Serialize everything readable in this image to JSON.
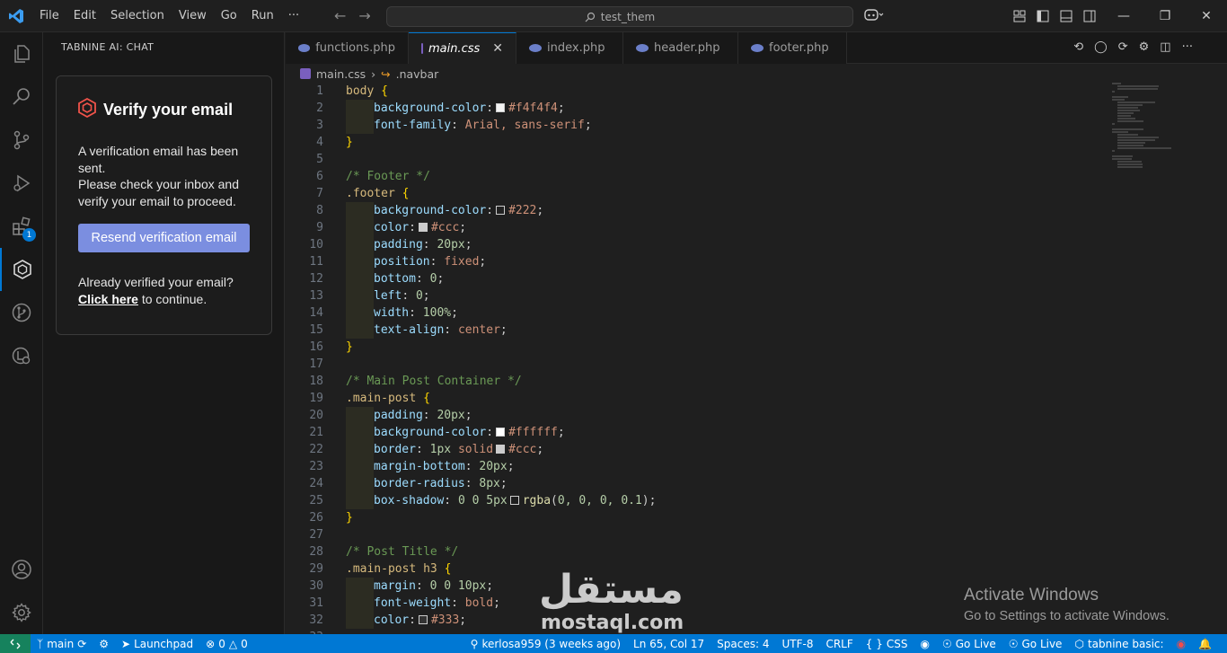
{
  "menu": [
    "File",
    "Edit",
    "Selection",
    "View",
    "Go",
    "Run",
    "···"
  ],
  "search": {
    "text": "test_them"
  },
  "side_panel": {
    "title": "TABNINE AI: CHAT",
    "card_title": "Verify your email",
    "line1": "A verification email has been sent.",
    "line2": "Please check your inbox and verify your email to proceed.",
    "button": "Resend verification email",
    "foot_pre": "Already verified your email?",
    "foot_link": "Click here",
    "foot_post": " to continue."
  },
  "activity": {
    "badge": "1"
  },
  "tabs": [
    {
      "label": "functions.php",
      "icon": "php"
    },
    {
      "label": "main.css",
      "icon": "css",
      "active": true
    },
    {
      "label": "index.php",
      "icon": "php"
    },
    {
      "label": "header.php",
      "icon": "php"
    },
    {
      "label": "footer.php",
      "icon": "php"
    }
  ],
  "breadcrumb": {
    "file": "main.css",
    "symbol": ".navbar"
  },
  "code": [
    [
      [
        "sel",
        "body"
      ],
      [
        "pun",
        " "
      ],
      [
        "brace",
        "{"
      ]
    ],
    [
      [
        "ind",
        ""
      ],
      [
        "prop",
        "background-color"
      ],
      [
        "pun",
        ":"
      ],
      [
        "sw",
        "#f4f4f4"
      ],
      [
        "val",
        "#f4f4f4"
      ],
      [
        "pun",
        ";"
      ]
    ],
    [
      [
        "ind",
        ""
      ],
      [
        "prop",
        "font-family"
      ],
      [
        "pun",
        ": "
      ],
      [
        "val",
        "Arial, sans-serif"
      ],
      [
        "pun",
        ";"
      ]
    ],
    [
      [
        "brace",
        "}"
      ]
    ],
    [],
    [
      [
        "cmt",
        "/* Footer */"
      ]
    ],
    [
      [
        "sel",
        ".footer"
      ],
      [
        "pun",
        " "
      ],
      [
        "brace",
        "{"
      ]
    ],
    [
      [
        "ind",
        ""
      ],
      [
        "prop",
        "background-color"
      ],
      [
        "pun",
        ":"
      ],
      [
        "sw",
        "#222222"
      ],
      [
        "val",
        "#222"
      ],
      [
        "pun",
        ";"
      ]
    ],
    [
      [
        "ind",
        ""
      ],
      [
        "prop",
        "color"
      ],
      [
        "pun",
        ":"
      ],
      [
        "sw",
        "#cccccc"
      ],
      [
        "val",
        "#ccc"
      ],
      [
        "pun",
        ";"
      ]
    ],
    [
      [
        "ind",
        ""
      ],
      [
        "prop",
        "padding"
      ],
      [
        "pun",
        ": "
      ],
      [
        "num",
        "20px"
      ],
      [
        "pun",
        ";"
      ]
    ],
    [
      [
        "ind",
        ""
      ],
      [
        "prop",
        "position"
      ],
      [
        "pun",
        ": "
      ],
      [
        "val",
        "fixed"
      ],
      [
        "pun",
        ";"
      ]
    ],
    [
      [
        "ind",
        ""
      ],
      [
        "prop",
        "bottom"
      ],
      [
        "pun",
        ": "
      ],
      [
        "num",
        "0"
      ],
      [
        "pun",
        ";"
      ]
    ],
    [
      [
        "ind",
        ""
      ],
      [
        "prop",
        "left"
      ],
      [
        "pun",
        ": "
      ],
      [
        "num",
        "0"
      ],
      [
        "pun",
        ";"
      ]
    ],
    [
      [
        "ind",
        ""
      ],
      [
        "prop",
        "width"
      ],
      [
        "pun",
        ": "
      ],
      [
        "num",
        "100%"
      ],
      [
        "pun",
        ";"
      ]
    ],
    [
      [
        "ind",
        ""
      ],
      [
        "prop",
        "text-align"
      ],
      [
        "pun",
        ": "
      ],
      [
        "val",
        "center"
      ],
      [
        "pun",
        ";"
      ]
    ],
    [
      [
        "brace",
        "}"
      ]
    ],
    [],
    [
      [
        "cmt",
        "/* Main Post Container */"
      ]
    ],
    [
      [
        "sel",
        ".main-post"
      ],
      [
        "pun",
        " "
      ],
      [
        "brace",
        "{"
      ]
    ],
    [
      [
        "ind",
        ""
      ],
      [
        "prop",
        "padding"
      ],
      [
        "pun",
        ": "
      ],
      [
        "num",
        "20px"
      ],
      [
        "pun",
        ";"
      ]
    ],
    [
      [
        "ind",
        ""
      ],
      [
        "prop",
        "background-color"
      ],
      [
        "pun",
        ":"
      ],
      [
        "sw",
        "#ffffff"
      ],
      [
        "val",
        "#ffffff"
      ],
      [
        "pun",
        ";"
      ]
    ],
    [
      [
        "ind",
        ""
      ],
      [
        "prop",
        "border"
      ],
      [
        "pun",
        ": "
      ],
      [
        "num",
        "1px"
      ],
      [
        "pun",
        " "
      ],
      [
        "val",
        "solid"
      ],
      [
        "sw",
        "#cccccc"
      ],
      [
        "val",
        "#ccc"
      ],
      [
        "pun",
        ";"
      ]
    ],
    [
      [
        "ind",
        ""
      ],
      [
        "prop",
        "margin-bottom"
      ],
      [
        "pun",
        ": "
      ],
      [
        "num",
        "20px"
      ],
      [
        "pun",
        ";"
      ]
    ],
    [
      [
        "ind",
        ""
      ],
      [
        "prop",
        "border-radius"
      ],
      [
        "pun",
        ": "
      ],
      [
        "num",
        "8px"
      ],
      [
        "pun",
        ";"
      ]
    ],
    [
      [
        "ind",
        ""
      ],
      [
        "prop",
        "box-shadow"
      ],
      [
        "pun",
        ": "
      ],
      [
        "num",
        "0 0 5px"
      ],
      [
        "sw",
        "#1f1f1f"
      ],
      [
        "fn",
        "rgba"
      ],
      [
        "pun",
        "("
      ],
      [
        "num",
        "0, 0, 0, 0.1"
      ],
      [
        "pun",
        ");"
      ]
    ],
    [
      [
        "brace",
        "}"
      ]
    ],
    [],
    [
      [
        "cmt",
        "/* Post Title */"
      ]
    ],
    [
      [
        "sel",
        ".main-post h3"
      ],
      [
        "pun",
        " "
      ],
      [
        "brace",
        "{"
      ]
    ],
    [
      [
        "ind",
        ""
      ],
      [
        "prop",
        "margin"
      ],
      [
        "pun",
        ": "
      ],
      [
        "num",
        "0 0 10px"
      ],
      [
        "pun",
        ";"
      ]
    ],
    [
      [
        "ind",
        ""
      ],
      [
        "prop",
        "font-weight"
      ],
      [
        "pun",
        ": "
      ],
      [
        "val",
        "bold"
      ],
      [
        "pun",
        ";"
      ]
    ],
    [
      [
        "ind",
        ""
      ],
      [
        "prop",
        "color"
      ],
      [
        "pun",
        ":"
      ],
      [
        "sw",
        "#333333"
      ],
      [
        "val",
        "#333"
      ],
      [
        "pun",
        ";"
      ]
    ],
    []
  ],
  "watermark": {
    "arabic": "مستقل",
    "latin": "mostaql.com"
  },
  "activation": {
    "title": "Activate Windows",
    "subtitle": "Go to Settings to activate Windows."
  },
  "status": {
    "branch": "main",
    "launchpad": "Launchpad",
    "errors": "0",
    "warnings": "0",
    "blame": "kerlosa959 (3 weeks ago)",
    "cursor": "Ln 65, Col 17",
    "spaces": "Spaces: 4",
    "encoding": "UTF-8",
    "eol": "CRLF",
    "language": "CSS",
    "golive1": "Go Live",
    "golive2": "Go Live",
    "tabnine": "tabnine basic:"
  }
}
